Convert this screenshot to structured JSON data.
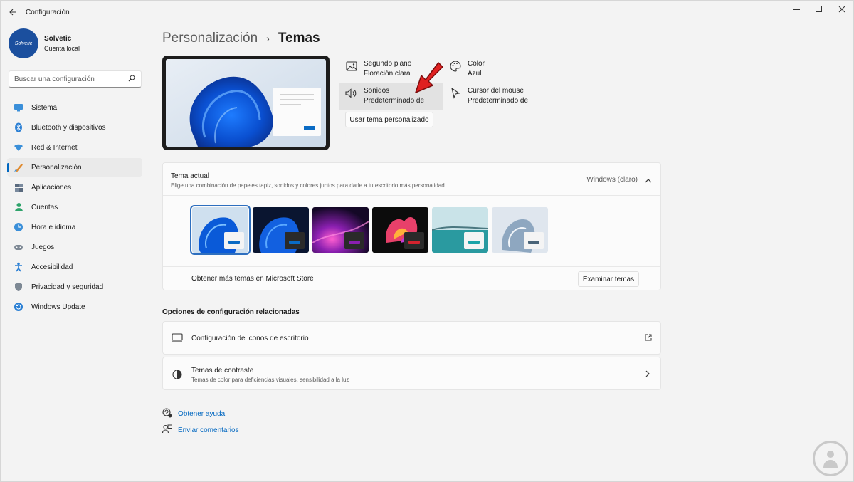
{
  "window": {
    "title": "Configuración",
    "back_icon": "arrow-left-icon",
    "minimize_glyph": "—",
    "maximize_glyph": "☐",
    "close_glyph": "✕"
  },
  "profile": {
    "avatar_text": "Solvetic",
    "name": "Solvetic",
    "account_type": "Cuenta local"
  },
  "search": {
    "placeholder": "Buscar una configuración"
  },
  "sidebar": {
    "items": [
      {
        "label": "Sistema",
        "icon": "monitor-icon",
        "active": false
      },
      {
        "label": "Bluetooth y dispositivos",
        "icon": "bluetooth-icon",
        "active": false
      },
      {
        "label": "Red & Internet",
        "icon": "wifi-icon",
        "active": false
      },
      {
        "label": "Personalización",
        "icon": "brush-icon",
        "active": true
      },
      {
        "label": "Aplicaciones",
        "icon": "apps-icon",
        "active": false
      },
      {
        "label": "Cuentas",
        "icon": "person-icon",
        "active": false
      },
      {
        "label": "Hora e idioma",
        "icon": "globe-clock-icon",
        "active": false
      },
      {
        "label": "Juegos",
        "icon": "gamepad-icon",
        "active": false
      },
      {
        "label": "Accesibilidad",
        "icon": "accessibility-icon",
        "active": false
      },
      {
        "label": "Privacidad y seguridad",
        "icon": "shield-icon",
        "active": false
      },
      {
        "label": "Windows Update",
        "icon": "update-icon",
        "active": false
      }
    ]
  },
  "breadcrumb": {
    "parent": "Personalización",
    "separator": "›",
    "current": "Temas"
  },
  "quick_settings": {
    "background": {
      "title": "Segundo plano",
      "value": "Floración clara"
    },
    "color": {
      "title": "Color",
      "value": "Azul"
    },
    "sounds": {
      "title": "Sonidos",
      "value": "Predeterminado de"
    },
    "cursor": {
      "title": "Cursor del mouse",
      "value": "Predeterminado de"
    },
    "custom_theme_button": "Usar tema personalizado"
  },
  "current_theme": {
    "title": "Tema actual",
    "subtitle": "Elige una combinación de papeles tapiz, sonidos y colores juntos para darle a tu escritorio más personalidad",
    "value": "Windows (claro)",
    "themes": [
      {
        "accent": "#0a6bc4",
        "window": "#f4f4f4",
        "selected": true
      },
      {
        "accent": "#0a6bc4",
        "window": "#2a2a2a",
        "selected": false
      },
      {
        "accent": "#8a1fb0",
        "window": "#2a2a2a",
        "selected": false
      },
      {
        "accent": "#d4232e",
        "window": "#2a2a2a",
        "selected": false
      },
      {
        "accent": "#1aa3a8",
        "window": "#f4f4f4",
        "selected": false
      },
      {
        "accent": "#4a6478",
        "window": "#f4f4f4",
        "selected": false
      }
    ],
    "store_text": "Obtener más temas en Microsoft Store",
    "browse_button": "Examinar temas"
  },
  "related": {
    "section_title": "Opciones de configuración relacionadas",
    "desktop_icons": "Configuración de iconos de escritorio",
    "contrast_title": "Temas de contraste",
    "contrast_sub": "Temas de color para deficiencias visuales, sensibilidad a la luz"
  },
  "help": {
    "get_help": "Obtener ayuda",
    "feedback": "Enviar comentarios"
  },
  "colors": {
    "accent": "#0067c0",
    "arrow_annotation": "#e02020"
  }
}
